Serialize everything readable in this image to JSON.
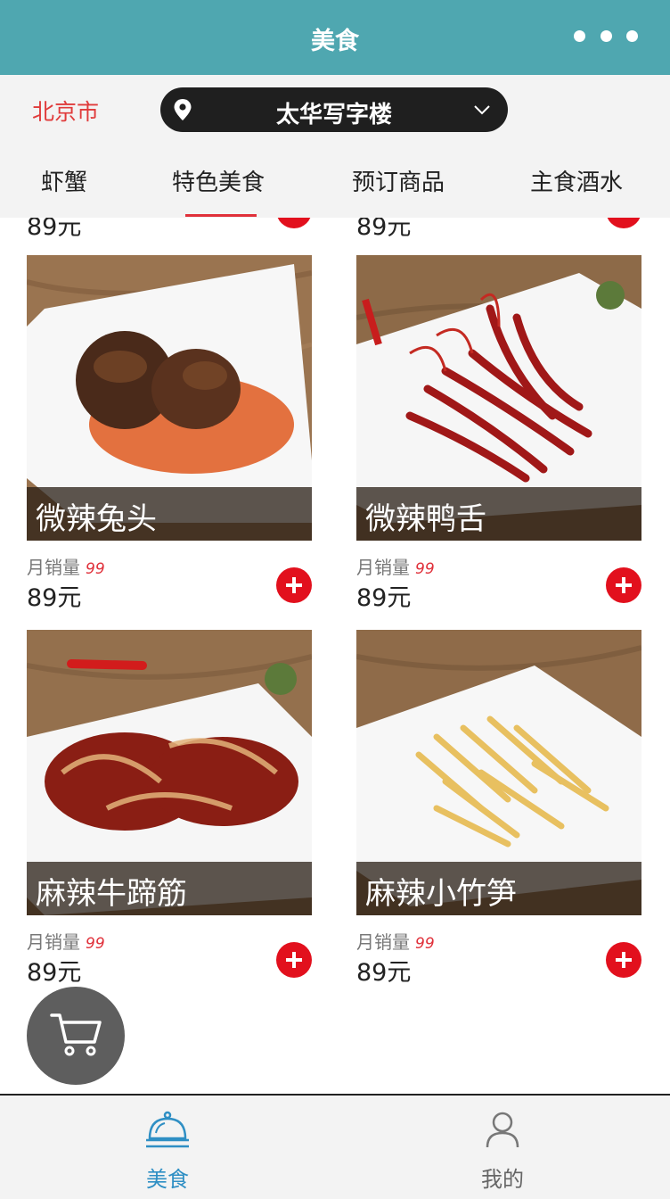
{
  "header": {
    "title": "美食",
    "more_icon": "more-dots-icon"
  },
  "location": {
    "city": "北京市",
    "address": "太华写字楼",
    "pin_icon": "location-pin-icon",
    "dropdown_icon": "chevron-down-icon"
  },
  "tabs": [
    {
      "label": "虾蟹"
    },
    {
      "label": "特色美食",
      "active": true
    },
    {
      "label": "预订商品"
    },
    {
      "label": "主食酒水"
    }
  ],
  "peek_row": {
    "left_price": "89元",
    "right_price": "89元"
  },
  "products": [
    {
      "name": "微辣兔头",
      "sales_label": "月销量",
      "sales": "99",
      "price": "89元"
    },
    {
      "name": "微辣鸭舌",
      "sales_label": "月销量",
      "sales": "99",
      "price": "89元"
    },
    {
      "name": "麻辣牛蹄筋",
      "sales_label": "月销量",
      "sales": "99",
      "price": "89元"
    },
    {
      "name": "麻辣小竹笋",
      "sales_label": "月销量",
      "sales": "99",
      "price": "89元"
    }
  ],
  "cart": {
    "icon": "shopping-cart-icon"
  },
  "bottom_nav": [
    {
      "label": "美食",
      "icon": "food-cloche-icon",
      "active": true
    },
    {
      "label": "我的",
      "icon": "user-profile-icon",
      "active": false
    }
  ],
  "colors": {
    "header_bg": "#4fa7b0",
    "accent_red": "#e2101d",
    "active_nav": "#2f8fc4"
  }
}
